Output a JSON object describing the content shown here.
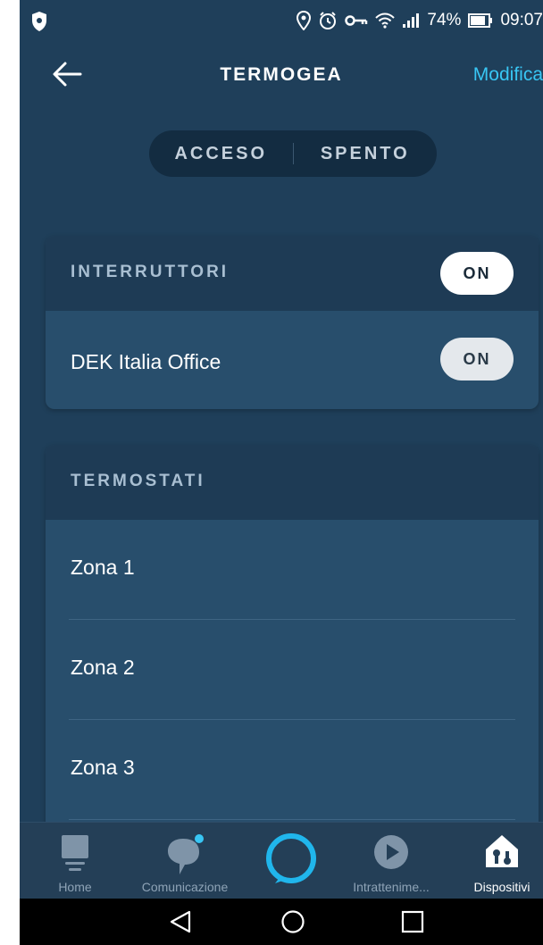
{
  "status_bar": {
    "battery": "74%",
    "time": "09:07"
  },
  "header": {
    "title": "TERMOGEA",
    "edit_label": "Modifica"
  },
  "segmented": {
    "on_label": "ACCESO",
    "off_label": "SPENTO"
  },
  "switches_card": {
    "title": "INTERRUTTORI",
    "toggle_label": "ON",
    "items": [
      {
        "label": "DEK Italia Office",
        "toggle_label": "ON"
      }
    ]
  },
  "thermostats_card": {
    "title": "TERMOSTATI",
    "items": [
      {
        "label": "Zona 1"
      },
      {
        "label": "Zona 2"
      },
      {
        "label": "Zona 3"
      }
    ]
  },
  "bottom_nav": {
    "items": [
      {
        "label": "Home",
        "icon": "home-icon"
      },
      {
        "label": "Comunicazione",
        "icon": "chat-bubble-icon"
      },
      {
        "label": "",
        "icon": "alexa-ring-icon"
      },
      {
        "label": "Intrattenime...",
        "icon": "play-icon"
      },
      {
        "label": "Dispositivi",
        "icon": "devices-icon"
      }
    ]
  },
  "colors": {
    "background": "#1f3f5a",
    "accent": "#38c6f4",
    "card_header": "#1e3b55",
    "card_body": "#284e6c"
  }
}
